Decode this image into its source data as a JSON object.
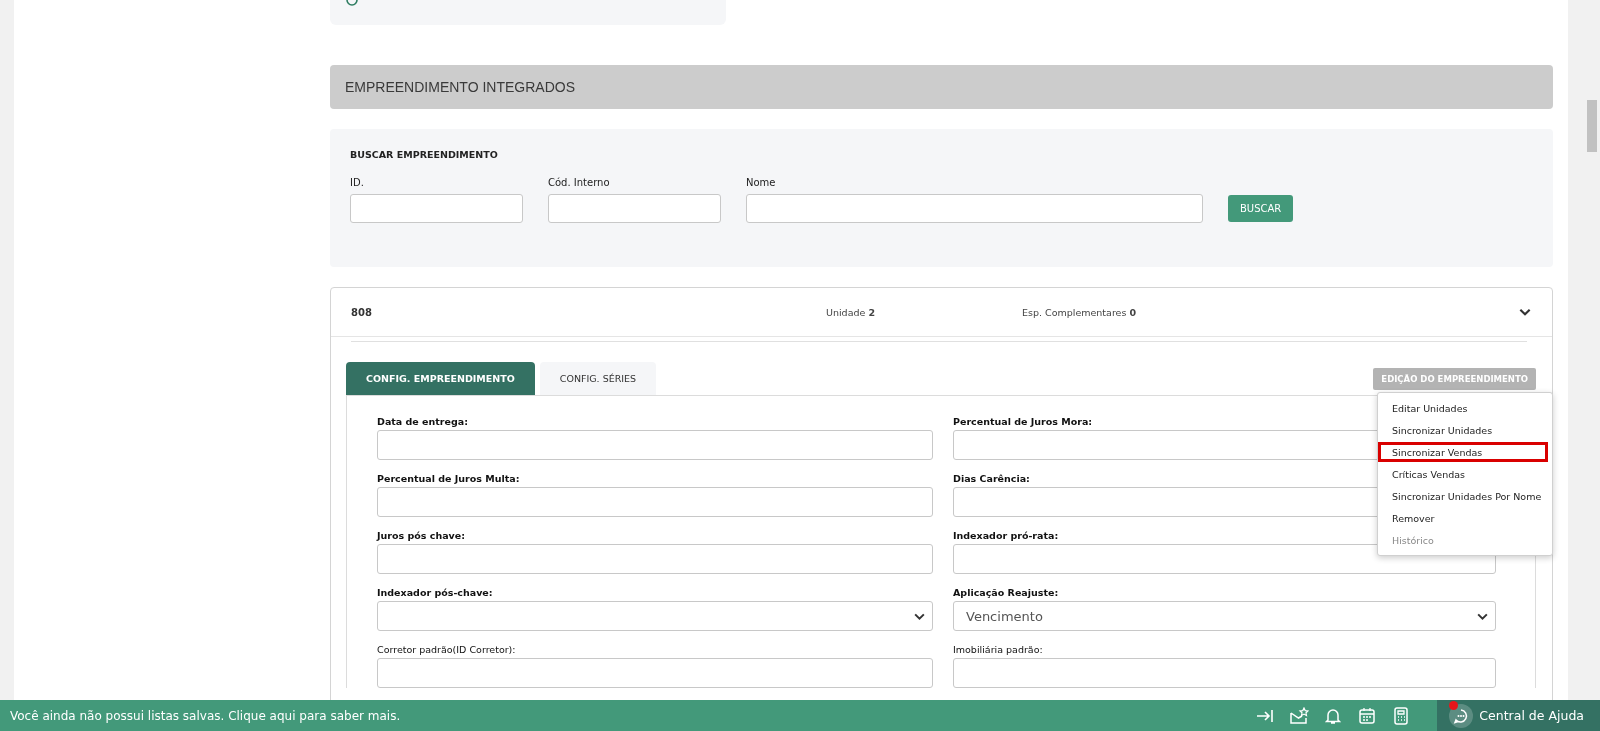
{
  "section_title": "EMPREENDIMENTO INTEGRADOS",
  "search": {
    "title": "BUSCAR EMPREENDIMENTO",
    "fields": [
      {
        "label": "ID."
      },
      {
        "label": "Cód. Interno"
      },
      {
        "label": "Nome"
      }
    ],
    "button": "BUSCAR"
  },
  "item": {
    "code": "808",
    "stats": [
      {
        "label": "Unidade",
        "value": "2"
      },
      {
        "label": "Esp. Complementares",
        "value": "0"
      }
    ]
  },
  "tabs": [
    {
      "label": "CONFIG. EMPREENDIMENTO",
      "selected": true
    },
    {
      "label": "CONFIG. SÉRIES",
      "selected": false
    }
  ],
  "edit_menu": {
    "button": "EDIÇÃO DO EMPREENDIMENTO",
    "items": [
      {
        "label": "Editar Unidades",
        "highlighted": false,
        "disabled": false
      },
      {
        "label": "Sincronizar Unidades",
        "highlighted": false,
        "disabled": false
      },
      {
        "label": "Sincronizar Vendas",
        "highlighted": true,
        "disabled": false
      },
      {
        "label": "Críticas Vendas",
        "highlighted": false,
        "disabled": false
      },
      {
        "label": "Sincronizar Unidades Por Nome",
        "highlighted": false,
        "disabled": false
      },
      {
        "label": "Remover",
        "highlighted": false,
        "disabled": false
      },
      {
        "label": "Histórico",
        "highlighted": false,
        "disabled": true
      }
    ]
  },
  "form": {
    "fields": [
      {
        "label": "Data de entrega:",
        "kind": "text",
        "bold": true
      },
      {
        "label": "Percentual de Juros Mora:",
        "kind": "text",
        "bold": true
      },
      {
        "label": "Percentual de Juros Multa:",
        "kind": "text",
        "bold": true
      },
      {
        "label": "Dias Carência:",
        "kind": "text",
        "bold": true
      },
      {
        "label": "Juros pós chave:",
        "kind": "text",
        "bold": true
      },
      {
        "label": "Indexador pró-rata:",
        "kind": "text",
        "bold": true
      },
      {
        "label": "Indexador pós-chave:",
        "kind": "select",
        "bold": true
      },
      {
        "label": "Aplicação Reajuste:",
        "kind": "select",
        "bold": true,
        "value": "Vencimento"
      },
      {
        "label": "Corretor padrão(ID Corretor):",
        "kind": "text",
        "bold": false
      },
      {
        "label": "Imobiliária padrão:",
        "kind": "text",
        "bold": false
      }
    ]
  },
  "bottom_bar": {
    "message": "Você ainda não possui listas salvas. Clique aqui para saber mais.",
    "help": {
      "label": "Central de Ajuda",
      "notification": true
    }
  }
}
